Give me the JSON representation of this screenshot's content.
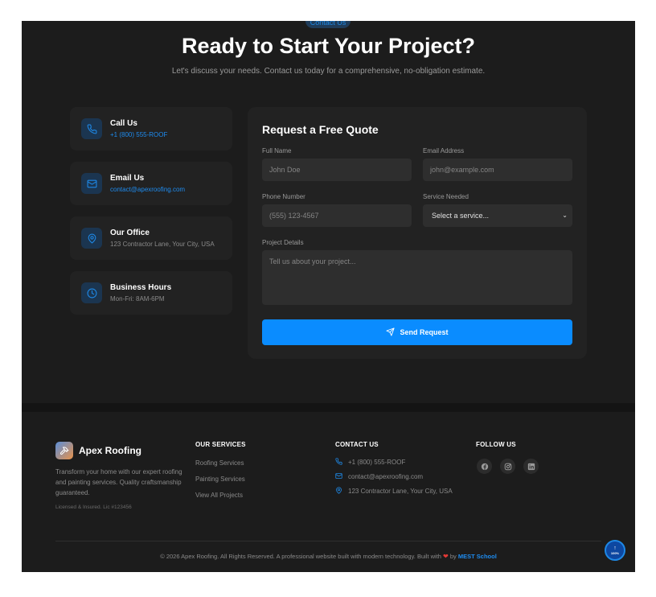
{
  "hero": {
    "pill": "Contact Us",
    "title": "Ready to Start Your Project?",
    "subtitle": "Let's discuss your needs. Contact us today for a comprehensive, no-obligation estimate."
  },
  "contact_cards": [
    {
      "title": "Call Us",
      "value": "+1 (800) 555-ROOF",
      "icon": "phone-icon"
    },
    {
      "title": "Email Us",
      "value": "contact@apexroofing.com",
      "icon": "mail-icon"
    },
    {
      "title": "Our Office",
      "value": "123 Contractor Lane, Your City, USA",
      "icon": "location-pin-icon"
    },
    {
      "title": "Business Hours",
      "value": "Mon-Fri: 8AM-6PM",
      "icon": "clock-icon"
    }
  ],
  "quote_form": {
    "title": "Request a Free Quote",
    "full_name": {
      "label": "Full Name",
      "placeholder": "John Doe"
    },
    "email": {
      "label": "Email Address",
      "placeholder": "john@example.com"
    },
    "phone": {
      "label": "Phone Number",
      "placeholder": "(555) 123-4567"
    },
    "service": {
      "label": "Service Needed",
      "selected": "Select a service..."
    },
    "details": {
      "label": "Project Details",
      "placeholder": "Tell us about your project..."
    },
    "submit_label": "Send Request"
  },
  "footer": {
    "brand": {
      "name": "Apex Roofing",
      "description": "Transform your home with our expert roofing and painting services. Quality craftsmanship guaranteed.",
      "license": "Licensed & Insured. Lic #123456"
    },
    "services": {
      "heading": "OUR SERVICES",
      "links": [
        "Roofing Services",
        "Painting Services",
        "View All Projects"
      ]
    },
    "contact": {
      "heading": "CONTACT US",
      "phone": "+1 (800) 555-ROOF",
      "email": "contact@apexroofing.com",
      "address": "123 Contractor Lane, Your City, USA"
    },
    "follow": {
      "heading": "FOLLOW US",
      "icons": [
        "facebook-icon",
        "instagram-icon",
        "linkedin-icon"
      ]
    },
    "copyright_pre": "© 2026 Apex Roofing. All Rights Reserved. A professional website built with modern technology. Built with",
    "copyright_by": "by",
    "copyright_link": "MEST School",
    "scroll_progress": "100%"
  },
  "colors": {
    "background": "#1c1c1c",
    "card": "#222222",
    "accent": "#0a8cff",
    "link": "#1e8cf0"
  }
}
